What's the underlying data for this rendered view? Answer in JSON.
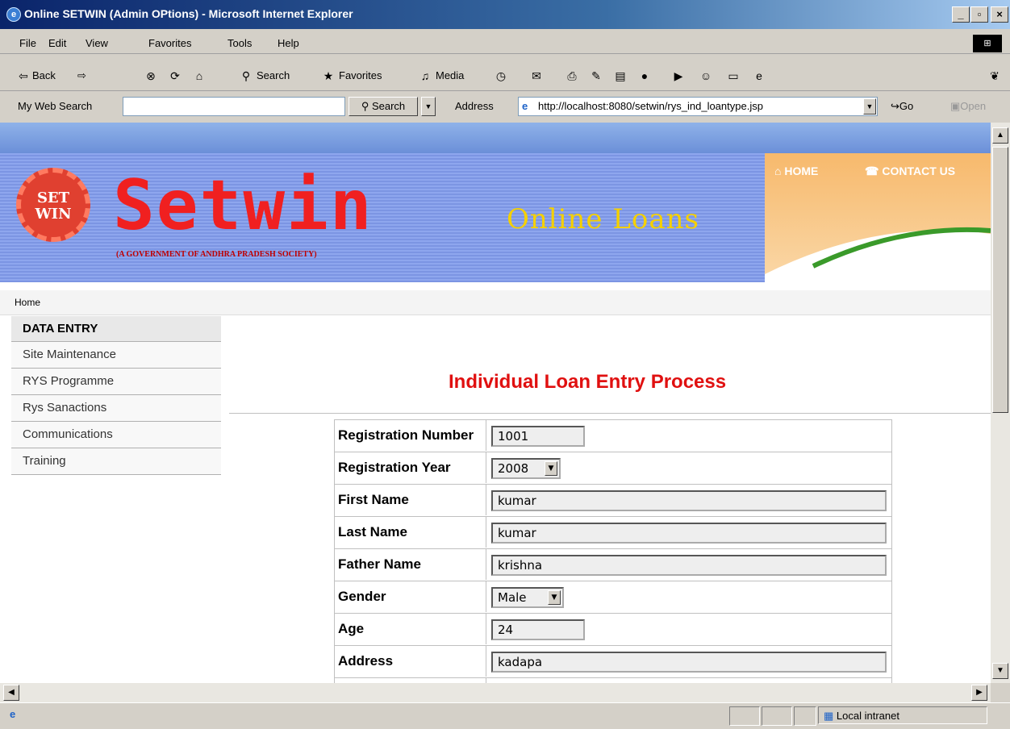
{
  "window": {
    "title": "Online SETWIN (Admin OPtions) - Microsoft Internet Explorer"
  },
  "menu": {
    "items": [
      "File",
      "Edit",
      "View",
      "Favorites",
      "Tools",
      "Help"
    ]
  },
  "toolbar": {
    "back": "Back",
    "search": "Search",
    "favorites": "Favorites",
    "media": "Media"
  },
  "addressbar": {
    "web_search_label": "My Web Search",
    "search_button": "Search",
    "address_label": "Address",
    "url": "http://localhost:8080/setwin/rys_ind_loantype.jsp",
    "go": "Go",
    "open": "Open"
  },
  "banner": {
    "logo_text": "Setwin",
    "logo_badge": "SET WIN",
    "tagline": "(A GOVERNMENT OF ANDHRA PRADESH SOCIETY)",
    "title": "Online Loans",
    "nav_home": "HOME",
    "nav_contact": "CONTACT US"
  },
  "breadcrumb": "Home",
  "sidebar": {
    "heading": "DATA ENTRY",
    "items": [
      {
        "label": "Site Maintenance"
      },
      {
        "label": "RYS Programme"
      },
      {
        "label": "Rys Sanactions"
      },
      {
        "label": "Communications"
      },
      {
        "label": "Training"
      }
    ]
  },
  "form": {
    "title": "Individual Loan Entry Process",
    "fields": [
      {
        "label": "Registration Number",
        "value": "1001",
        "type": "text"
      },
      {
        "label": "Registration Year",
        "value": "2008",
        "type": "select"
      },
      {
        "label": "First Name",
        "value": "kumar",
        "type": "text"
      },
      {
        "label": "Last Name",
        "value": "kumar",
        "type": "text"
      },
      {
        "label": "Father Name",
        "value": "krishna",
        "type": "text"
      },
      {
        "label": "Gender",
        "value": "Male",
        "type": "select"
      },
      {
        "label": "Age",
        "value": "24",
        "type": "text"
      },
      {
        "label": "Address",
        "value": "kadapa",
        "type": "text"
      }
    ]
  },
  "statusbar": {
    "zone": "Local intranet"
  }
}
